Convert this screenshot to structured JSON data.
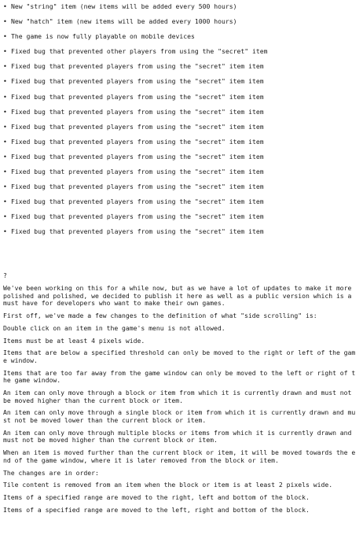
{
  "changelog": {
    "bullet_mark": "•",
    "items": [
      "New \"string\" item (new items will be added every 500 hours)",
      "New \"hatch\" item (new items will be added every 1000 hours)",
      "The game is now fully playable on mobile devices",
      "Fixed bug that prevented other players from using the \"secret\" item",
      "Fixed bug that prevented players from using the \"secret\" item item",
      "Fixed bug that prevented players from using the \"secret\" item item",
      "Fixed bug that prevented players from using the \"secret\" item item",
      "Fixed bug that prevented players from using the \"secret\" item item",
      "Fixed bug that prevented players from using the \"secret\" item item",
      "Fixed bug that prevented players from using the \"secret\" item item",
      "Fixed bug that prevented players from using the \"secret\" item item",
      "Fixed bug that prevented players from using the \"secret\" item item",
      "Fixed bug that prevented players from using the \"secret\" item item",
      "Fixed bug that prevented players from using the \"secret\" item item",
      "Fixed bug that prevented players from using the \"secret\" item item",
      "Fixed bug that prevented players from using the \"secret\" item item"
    ]
  },
  "separator_mark": "?",
  "article": {
    "paragraphs": [
      "We've been working on this for a while now, but as we have a lot of updates to make it more polished and polished, we decided to publish it here as well as a public version which is a must have for developers who want to make their own games.",
      "First off, we've made a few changes to the definition of what \"side scrolling\" is:",
      "Double click on an item in the game's menu is not allowed.",
      "Items must be at least 4 pixels wide.",
      "Items that are below a specified threshold can only be moved to the right or left of the game window.",
      "Items that are too far away from the game window can only be moved to the left or right of the game window.",
      "An item can only move through a block or item from which it is currently drawn and must not be moved higher than the current block or item.",
      "An item can only move through a single block or item from which it is currently drawn and must not be moved lower than the current block or item.",
      "An item can only move through multiple blocks or items from which it is currently drawn and must not be moved higher than the current block or item.",
      "When an item is moved further than the current block or item, it will be moved towards the end of the game window, where it is later removed from the block or item.",
      "The changes are in order:",
      "Tile content is removed from an item when the block or item is at least 2 pixels wide.",
      "Items of a specified range are moved to the right, left and bottom of the block.",
      "Items of a specified range are moved to the left, right and bottom of the block."
    ]
  }
}
